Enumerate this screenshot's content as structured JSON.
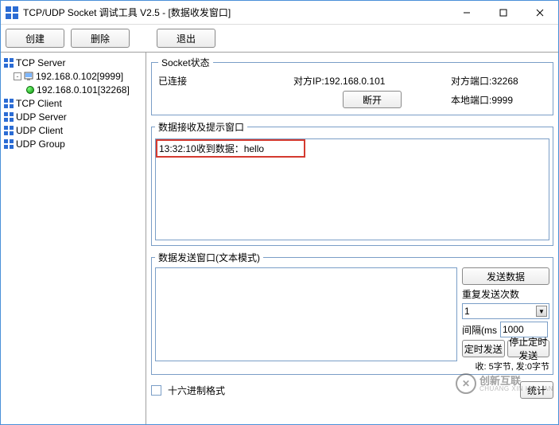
{
  "window": {
    "title": "TCP/UDP Socket 调试工具 V2.5 - [数据收发窗口]"
  },
  "toolbar": {
    "create": "创建",
    "delete": "删除",
    "exit": "退出"
  },
  "tree": {
    "n0": "TCP Server",
    "n1": "192.168.0.102[9999]",
    "n2": "192.168.0.101[32268]",
    "n3": "TCP Client",
    "n4": "UDP Server",
    "n5": "UDP Client",
    "n6": "UDP Group"
  },
  "socket": {
    "legend": "Socket状态",
    "status": "已连接",
    "peer_ip_label": "对方IP:192.168.0.101",
    "peer_port_label": "对方端口:32268",
    "disconnect": "断开",
    "local_port_label": "本地端口:9999"
  },
  "recv": {
    "legend": "数据接收及提示窗口",
    "line1": "13:32:10收到数据：hello"
  },
  "send": {
    "legend": "数据发送窗口(文本模式)",
    "send_btn": "发送数据",
    "repeat_label": "重复发送次数",
    "repeat_value": "1",
    "interval_label": "间隔(ms",
    "interval_value": "1000",
    "timed_send": "定时发送",
    "stop_timed": "停止定时发送",
    "stats": "收: 5字节, 发:0字节"
  },
  "bottom": {
    "hex_label": "十六进制格式",
    "stat_btn": "统计"
  },
  "watermark": {
    "main": "创新互联",
    "sub": "CHUANG XIN HU LIAN"
  }
}
